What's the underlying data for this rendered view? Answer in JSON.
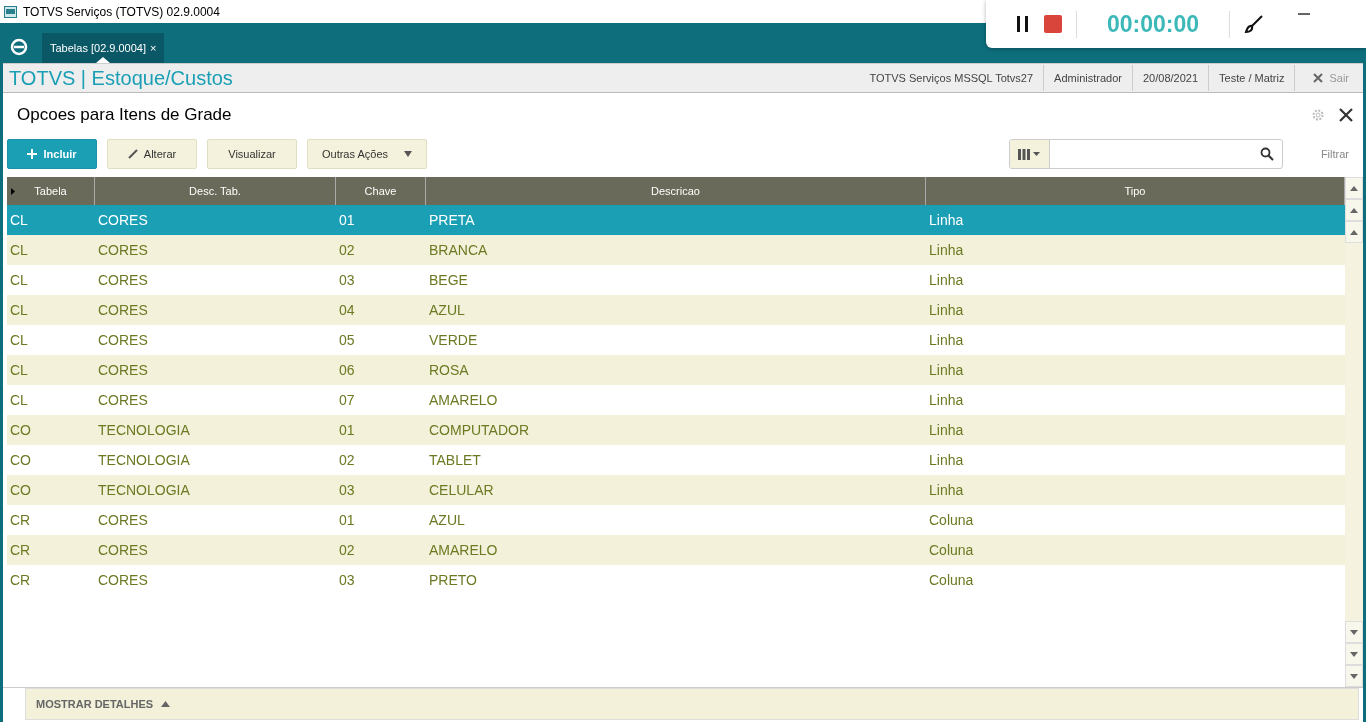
{
  "window": {
    "title": "TOTVS Serviços (TOTVS) 02.9.0004"
  },
  "tabs": [
    {
      "label": "Tabelas [02.9.0004]",
      "close": "×",
      "selected": true
    }
  ],
  "recorder": {
    "timer": "00:00:00"
  },
  "header": {
    "brand": "TOTVS | Estoque/Custos",
    "info": [
      "TOTVS Serviços MSSQL Totvs27",
      "Administrador",
      "20/08/2021",
      "Teste / Matriz"
    ],
    "exit": "Sair"
  },
  "page_title": "Opcoes para Itens de Grade",
  "actions": [
    {
      "label": "Incluir",
      "kind": "primary"
    },
    {
      "label": "Alterar",
      "kind": "edit"
    },
    {
      "label": "Visualizar",
      "kind": "plain"
    },
    {
      "label": "Outras Ações",
      "kind": "menu"
    }
  ],
  "filter": {
    "label": "Filtrar"
  },
  "table": {
    "columns": [
      "Tabela",
      "Desc. Tab.",
      "Chave",
      "Descricao",
      "Tipo"
    ],
    "rows": [
      {
        "cells": [
          "CL",
          "CORES",
          "01",
          "PRETA",
          "Linha"
        ],
        "selected": true
      },
      {
        "cells": [
          "CL",
          "CORES",
          "02",
          "BRANCA",
          "Linha"
        ],
        "selected": false
      },
      {
        "cells": [
          "CL",
          "CORES",
          "03",
          "BEGE",
          "Linha"
        ],
        "selected": false
      },
      {
        "cells": [
          "CL",
          "CORES",
          "04",
          "AZUL",
          "Linha"
        ],
        "selected": false
      },
      {
        "cells": [
          "CL",
          "CORES",
          "05",
          "VERDE",
          "Linha"
        ],
        "selected": false
      },
      {
        "cells": [
          "CL",
          "CORES",
          "06",
          "ROSA",
          "Linha"
        ],
        "selected": false
      },
      {
        "cells": [
          "CL",
          "CORES",
          "07",
          "AMARELO",
          "Linha"
        ],
        "selected": false
      },
      {
        "cells": [
          "CO",
          "TECNOLOGIA",
          "01",
          "COMPUTADOR",
          "Linha"
        ],
        "selected": false
      },
      {
        "cells": [
          "CO",
          "TECNOLOGIA",
          "02",
          "TABLET",
          "Linha"
        ],
        "selected": false
      },
      {
        "cells": [
          "CO",
          "TECNOLOGIA",
          "03",
          "CELULAR",
          "Linha"
        ],
        "selected": false
      },
      {
        "cells": [
          "CR",
          "CORES",
          "01",
          "AZUL",
          "Coluna"
        ],
        "selected": false
      },
      {
        "cells": [
          "CR",
          "CORES",
          "02",
          "AMARELO",
          "Coluna"
        ],
        "selected": false
      },
      {
        "cells": [
          "CR",
          "CORES",
          "03",
          "PRETO",
          "Coluna"
        ],
        "selected": false
      }
    ]
  },
  "details": {
    "label": "MOSTRAR DETALHES"
  }
}
